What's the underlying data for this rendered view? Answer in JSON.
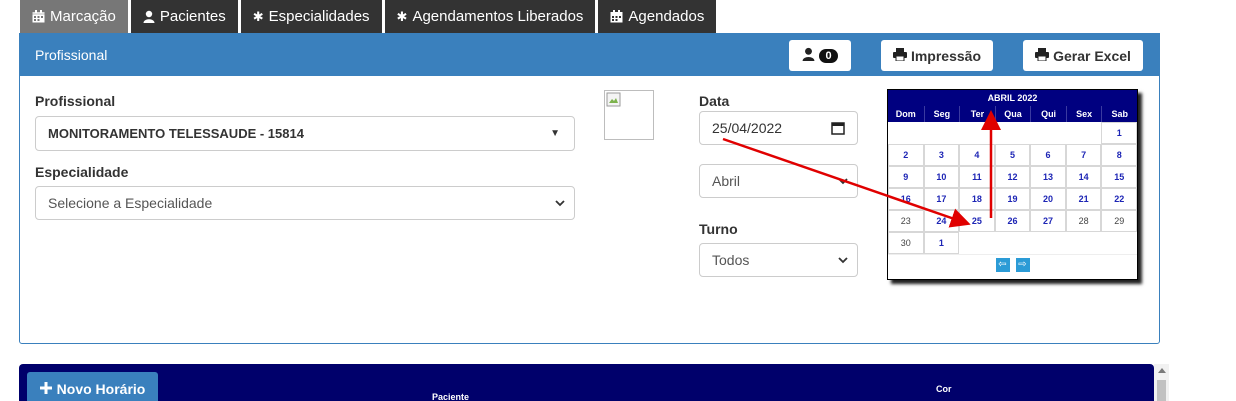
{
  "tabs": [
    {
      "label": "Marcação",
      "icon": "calendar-icon",
      "active": true
    },
    {
      "label": "Pacientes",
      "icon": "user-icon",
      "active": false
    },
    {
      "label": "Especialidades",
      "icon": "asterisk-icon",
      "active": false
    },
    {
      "label": "Agendamentos Liberados",
      "icon": "asterisk-icon",
      "active": false
    },
    {
      "label": "Agendados",
      "icon": "calendar-icon",
      "active": false
    }
  ],
  "panel": {
    "title": "Profissional",
    "user_count": "0",
    "print_label": "Impressão",
    "excel_label": "Gerar Excel"
  },
  "form": {
    "profissional_label": "Profissional",
    "profissional_value": "MONITORAMENTO TELESSAUDE - 15814",
    "especialidade_label": "Especialidade",
    "especialidade_placeholder": "Selecione a Especialidade",
    "data_label": "Data",
    "data_value": "25/04/2022",
    "mes_value": "Abril",
    "turno_label": "Turno",
    "turno_value": "Todos"
  },
  "calendar": {
    "title": "ABRIL 2022",
    "weekdays": [
      "Dom",
      "Seg",
      "Ter",
      "Qua",
      "Qui",
      "Sex",
      "Sab"
    ],
    "weeks": [
      [
        "",
        "",
        "",
        "",
        "",
        "",
        "1"
      ],
      [
        "2",
        "3",
        "4",
        "5",
        "6",
        "7",
        "8"
      ],
      [
        "9",
        "10",
        "11",
        "12",
        "13",
        "14",
        "15"
      ],
      [
        "16",
        "17",
        "18",
        "19",
        "20",
        "21",
        "22"
      ],
      [
        "23",
        "24",
        "25",
        "26",
        "27",
        "28",
        "29"
      ],
      [
        "30",
        "1",
        "",
        "",
        "",
        "",
        ""
      ]
    ]
  },
  "table": {
    "new_button_label": "Novo Horário",
    "col_paciente": "Paciente",
    "col_cor": "Cor"
  },
  "colors": {
    "primary": "#3a80bd",
    "tab_dark": "#333333",
    "calendar_header": "#000080",
    "annotation_arrow": "#e00000"
  }
}
